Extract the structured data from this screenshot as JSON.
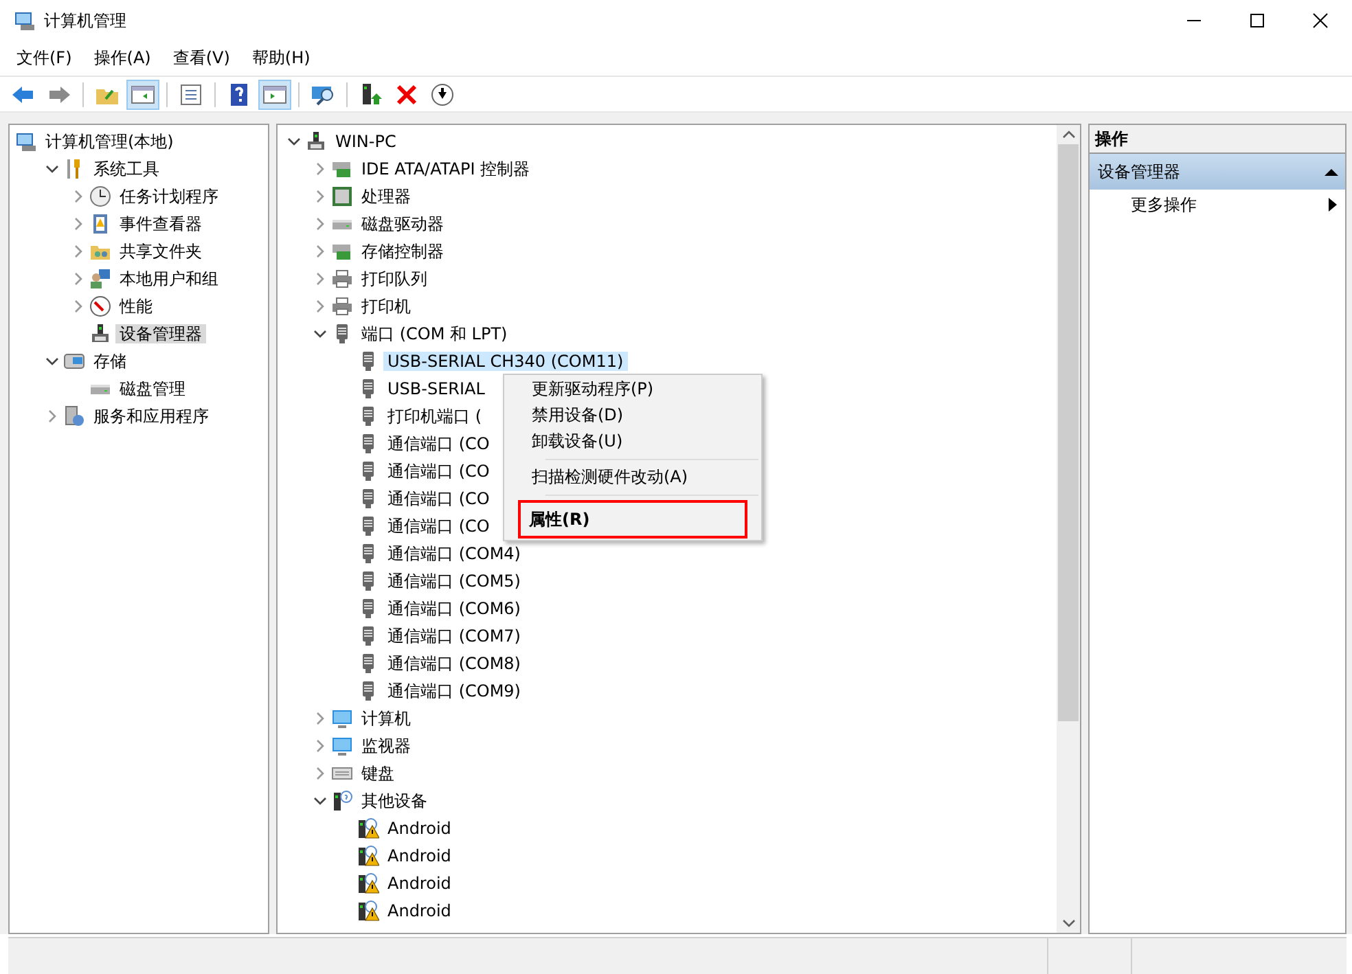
{
  "window": {
    "title": "计算机管理"
  },
  "menu_bar": [
    "文件(F)",
    "操作(A)",
    "查看(V)",
    "帮助(H)"
  ],
  "toolbar": [
    {
      "kind": "back",
      "pressed": false
    },
    {
      "kind": "forward",
      "pressed": false
    },
    {
      "kind": "separator"
    },
    {
      "kind": "up",
      "pressed": false
    },
    {
      "kind": "tree",
      "pressed": true
    },
    {
      "kind": "separator"
    },
    {
      "kind": "props",
      "pressed": false
    },
    {
      "kind": "separator"
    },
    {
      "kind": "help",
      "pressed": false
    },
    {
      "kind": "pane",
      "pressed": true
    },
    {
      "kind": "separator"
    },
    {
      "kind": "scan",
      "pressed": false
    },
    {
      "kind": "separator"
    },
    {
      "kind": "update",
      "pressed": false
    },
    {
      "kind": "delete",
      "pressed": false
    },
    {
      "kind": "down",
      "pressed": false
    }
  ],
  "sidebar": {
    "items": [
      {
        "label": "计算机管理(本地)",
        "kind": "mgmt",
        "selected": false,
        "children": [
          {
            "label": "系统工具",
            "kind": "tools",
            "expanded": true,
            "selected": false,
            "children": [
              {
                "label": "任务计划程序",
                "kind": "clock",
                "expanded": false,
                "selected": false
              },
              {
                "label": "事件查看器",
                "kind": "event",
                "expanded": false,
                "selected": false
              },
              {
                "label": "共享文件夹",
                "kind": "share",
                "expanded": false,
                "selected": false
              },
              {
                "label": "本地用户和组",
                "kind": "users",
                "expanded": false,
                "selected": false
              },
              {
                "label": "性能",
                "kind": "perf",
                "expanded": false,
                "selected": false
              },
              {
                "label": "设备管理器",
                "kind": "devmgr",
                "selected": true
              }
            ]
          },
          {
            "label": "存储",
            "kind": "storage",
            "expanded": true,
            "selected": false,
            "children": [
              {
                "label": "磁盘管理",
                "kind": "disk",
                "selected": false
              }
            ]
          },
          {
            "label": "服务和应用程序",
            "kind": "services",
            "expanded": false,
            "selected": false
          }
        ]
      }
    ]
  },
  "device_tree": {
    "items": [
      {
        "label": "WIN-PC",
        "kind": "devmgr",
        "expanded": true,
        "selected": false,
        "children": [
          {
            "label": "IDE ATA/ATAPI 控制器",
            "kind": "ide",
            "expanded": false,
            "selected": false
          },
          {
            "label": "处理器",
            "kind": "cpu",
            "expanded": false,
            "selected": false
          },
          {
            "label": "磁盘驱动器",
            "kind": "disk",
            "expanded": false,
            "selected": false
          },
          {
            "label": "存储控制器",
            "kind": "ide",
            "expanded": false,
            "selected": false
          },
          {
            "label": "打印队列",
            "kind": "printer",
            "expanded": false,
            "selected": false
          },
          {
            "label": "打印机",
            "kind": "printer",
            "expanded": false,
            "selected": false
          },
          {
            "label": "端口 (COM 和 LPT)",
            "kind": "port",
            "expanded": true,
            "selected": false,
            "children": [
              {
                "label": "USB-SERIAL CH340 (COM11)",
                "kind": "port",
                "selected": true
              },
              {
                "label": "USB-SERIAL",
                "kind": "port",
                "selected": false
              },
              {
                "label": "打印机端口 (",
                "kind": "port",
                "selected": false
              },
              {
                "label": "通信端口 (CO",
                "kind": "port",
                "selected": false
              },
              {
                "label": "通信端口 (CO",
                "kind": "port",
                "selected": false
              },
              {
                "label": "通信端口 (CO",
                "kind": "port",
                "selected": false
              },
              {
                "label": "通信端口 (CO",
                "kind": "port",
                "selected": false
              },
              {
                "label": "通信端口 (COM4)",
                "kind": "port",
                "selected": false
              },
              {
                "label": "通信端口 (COM5)",
                "kind": "port",
                "selected": false
              },
              {
                "label": "通信端口 (COM6)",
                "kind": "port",
                "selected": false
              },
              {
                "label": "通信端口 (COM7)",
                "kind": "port",
                "selected": false
              },
              {
                "label": "通信端口 (COM8)",
                "kind": "port",
                "selected": false
              },
              {
                "label": "通信端口 (COM9)",
                "kind": "port",
                "selected": false
              }
            ]
          },
          {
            "label": "计算机",
            "kind": "monitor",
            "expanded": false,
            "selected": false
          },
          {
            "label": "监视器",
            "kind": "monitor",
            "expanded": false,
            "selected": false
          },
          {
            "label": "键盘",
            "kind": "keyboard",
            "expanded": false,
            "selected": false
          },
          {
            "label": "其他设备",
            "kind": "other",
            "expanded": true,
            "selected": false,
            "children": [
              {
                "label": "Android",
                "kind": "warn",
                "selected": false
              },
              {
                "label": "Android",
                "kind": "warn",
                "selected": false
              },
              {
                "label": "Android",
                "kind": "warn",
                "selected": false
              },
              {
                "label": "Android",
                "kind": "warn",
                "selected": false
              }
            ]
          }
        ]
      }
    ]
  },
  "context_menu": {
    "items": [
      {
        "kind": "item",
        "label": "更新驱动程序(P)",
        "highlighted": false
      },
      {
        "kind": "item",
        "label": "禁用设备(D)",
        "highlighted": false
      },
      {
        "kind": "item",
        "label": "卸载设备(U)",
        "highlighted": false
      },
      {
        "kind": "separator"
      },
      {
        "kind": "item",
        "label": "扫描检测硬件改动(A)",
        "highlighted": false
      },
      {
        "kind": "separator"
      },
      {
        "kind": "item",
        "label": "属性(R)",
        "highlighted": true,
        "bold": true
      }
    ]
  },
  "actions_pane": {
    "title": "操作",
    "section": {
      "label": "设备管理器",
      "expanded": true
    },
    "items": [
      "更多操作"
    ]
  }
}
